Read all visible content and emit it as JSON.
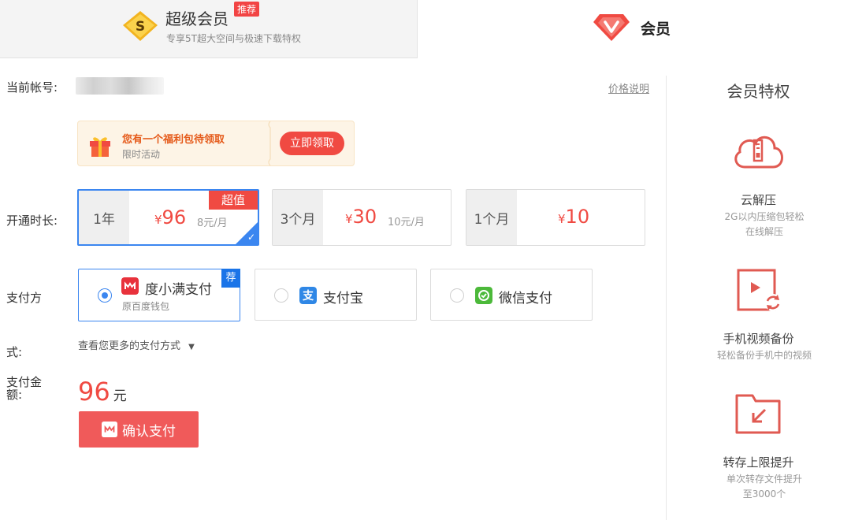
{
  "tabs": {
    "super": {
      "title": "超级会员",
      "badge": "推荐",
      "subtitle": "专享5T超大空间与极速下载特权",
      "icon": "s-diamond-icon"
    },
    "vip": {
      "title": "会员",
      "icon": "v-heart-icon"
    }
  },
  "account": {
    "label": "当前帐号:",
    "price_link": "价格说明"
  },
  "gift": {
    "title": "您有一个福利包待领取",
    "subtitle": "限时活动",
    "button": "立即领取"
  },
  "duration": {
    "label": "开通时长:",
    "options": [
      {
        "name": "1年",
        "yen": "¥",
        "price": "96",
        "per_month": "8元/月",
        "tag": "超值",
        "selected": true
      },
      {
        "name": "3个月",
        "yen": "¥",
        "price": "30",
        "per_month": "10元/月",
        "selected": false
      },
      {
        "name": "1个月",
        "yen": "¥",
        "price": "10",
        "per_month": "",
        "selected": false
      }
    ]
  },
  "payment": {
    "label_top": "支付方",
    "label_bottom": "式:",
    "options": [
      {
        "name": "度小满支付",
        "sub": "原百度钱包",
        "badge": "荐",
        "selected": true,
        "icon": "duxiaoman-icon",
        "color": "#e8323c"
      },
      {
        "name": "支付宝",
        "selected": false,
        "icon": "alipay-icon",
        "color": "#2f87e6"
      },
      {
        "name": "微信支付",
        "selected": false,
        "icon": "wechat-pay-icon",
        "color": "#4cb93a"
      }
    ],
    "more": "查看您更多的支付方式"
  },
  "amount": {
    "label_top": "支付金",
    "label_bottom": "额:",
    "value": "96",
    "unit": "元"
  },
  "confirm_button": "确认支付",
  "benefits": {
    "title": "会员特权",
    "items": [
      {
        "name": "云解压",
        "desc_line1": "2G以内压缩包轻松",
        "desc_line2": "在线解压",
        "icon": "cloud-zip-icon"
      },
      {
        "name": "手机视频备份",
        "desc_line1": "轻松备份手机中的视频",
        "desc_line2": "",
        "icon": "video-backup-icon"
      },
      {
        "name": "转存上限提升",
        "desc_line1": "单次转存文件提升",
        "desc_line2": "至3000个",
        "icon": "folder-transfer-icon"
      }
    ]
  },
  "colors": {
    "accent_red": "#f04a42",
    "accent_blue": "#3b86f0"
  }
}
